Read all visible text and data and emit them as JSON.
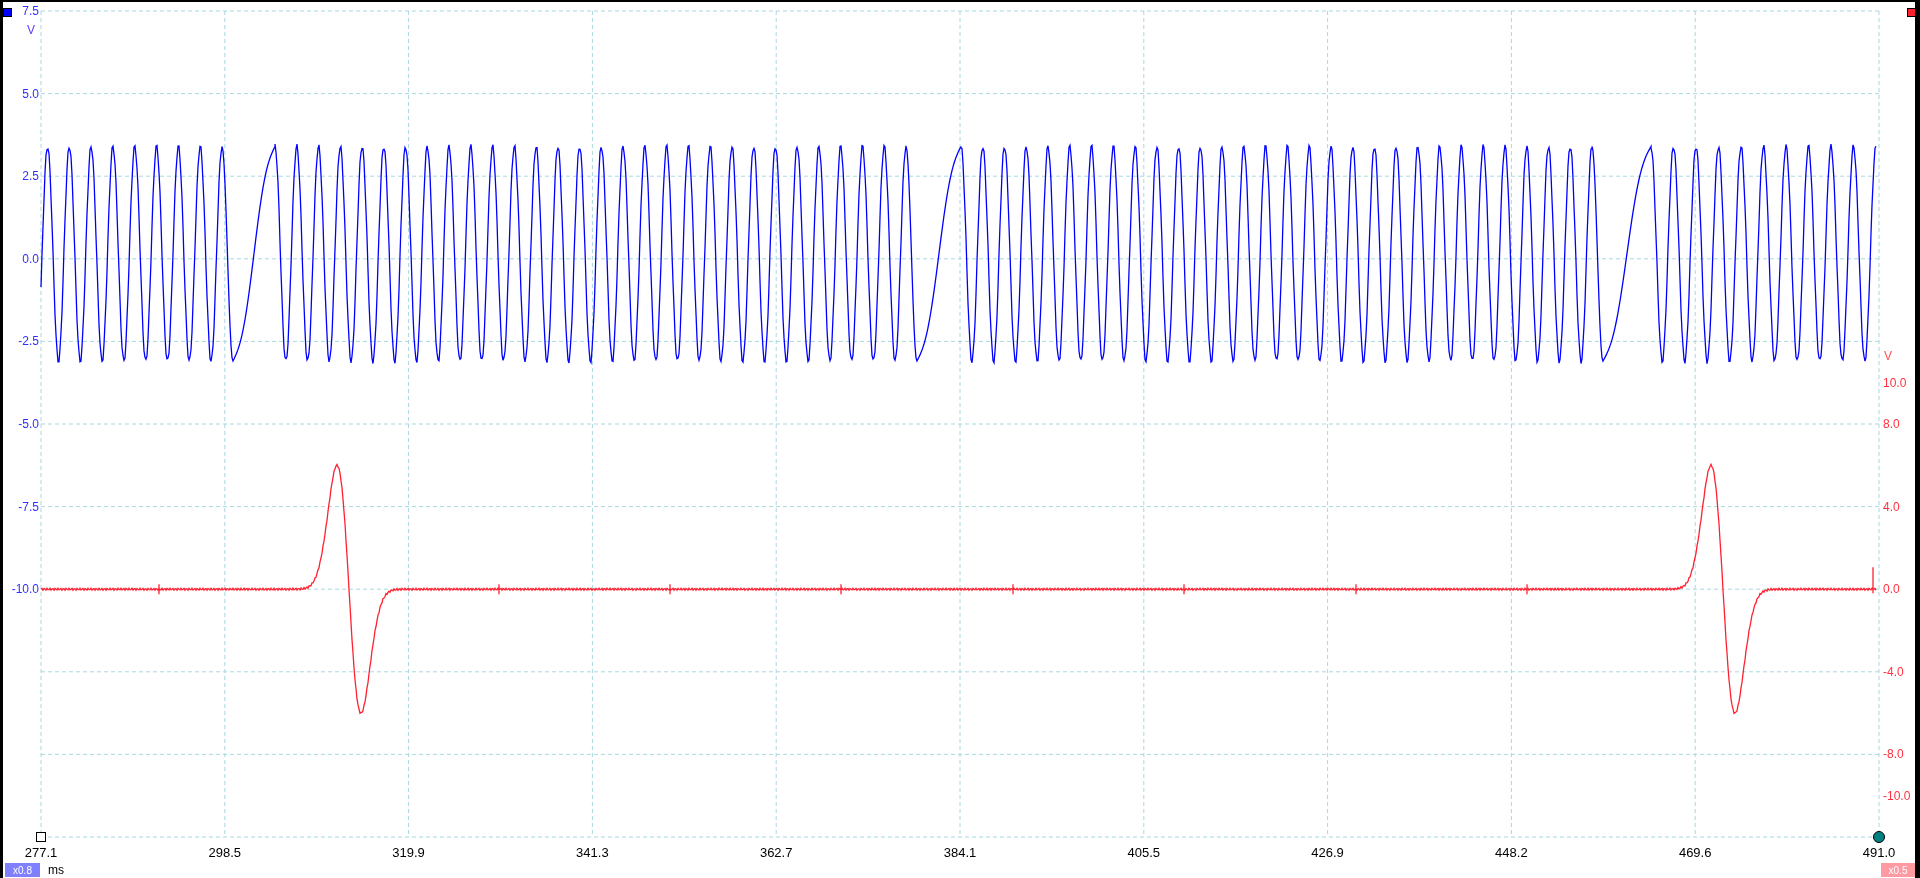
{
  "channels": [
    {
      "color": "#0000ff",
      "unit": "V",
      "scale": "x0.8",
      "ticks": [
        "7.5",
        "5.0",
        "2.5",
        "0.0",
        "-2.5",
        "-5.0",
        "-7.5",
        "-10.0"
      ]
    },
    {
      "color": "#ff2030",
      "unit": "V",
      "scale": "x0.5",
      "ticks": [
        "10.0",
        "8.0",
        "4.0",
        "0.0",
        "-4.0",
        "-8.0",
        "-10.0"
      ]
    }
  ],
  "time_axis": {
    "unit": "ms",
    "ticks": [
      "277.1",
      "298.5",
      "319.9",
      "341.3",
      "362.7",
      "384.1",
      "405.5",
      "426.9",
      "448.2",
      "469.6",
      "491.0"
    ]
  }
}
